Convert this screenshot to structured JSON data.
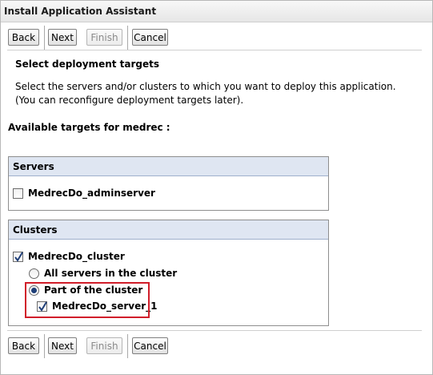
{
  "window": {
    "title": "Install Application Assistant"
  },
  "toolbar": {
    "back_label": "Back",
    "next_label": "Next",
    "finish_label": "Finish",
    "cancel_label": "Cancel"
  },
  "page": {
    "section_title": "Select deployment targets",
    "description": "Select the servers and/or clusters to which you want to deploy this application. (You can reconfigure deployment targets later).",
    "available_label": "Available targets for medrec :"
  },
  "servers": {
    "header": "Servers",
    "items": [
      {
        "label": "MedrecDo_adminserver",
        "checked": false
      }
    ]
  },
  "clusters": {
    "header": "Clusters",
    "cluster_label": "MedrecDo_cluster",
    "option_all": "All servers in the cluster",
    "option_part": "Part of the cluster",
    "server_label": "MedrecDo_server_1"
  },
  "colors": {
    "header_bg": "#dfe6f2",
    "highlight": "#d11e2a",
    "radio_dot": "#1f3f78"
  }
}
